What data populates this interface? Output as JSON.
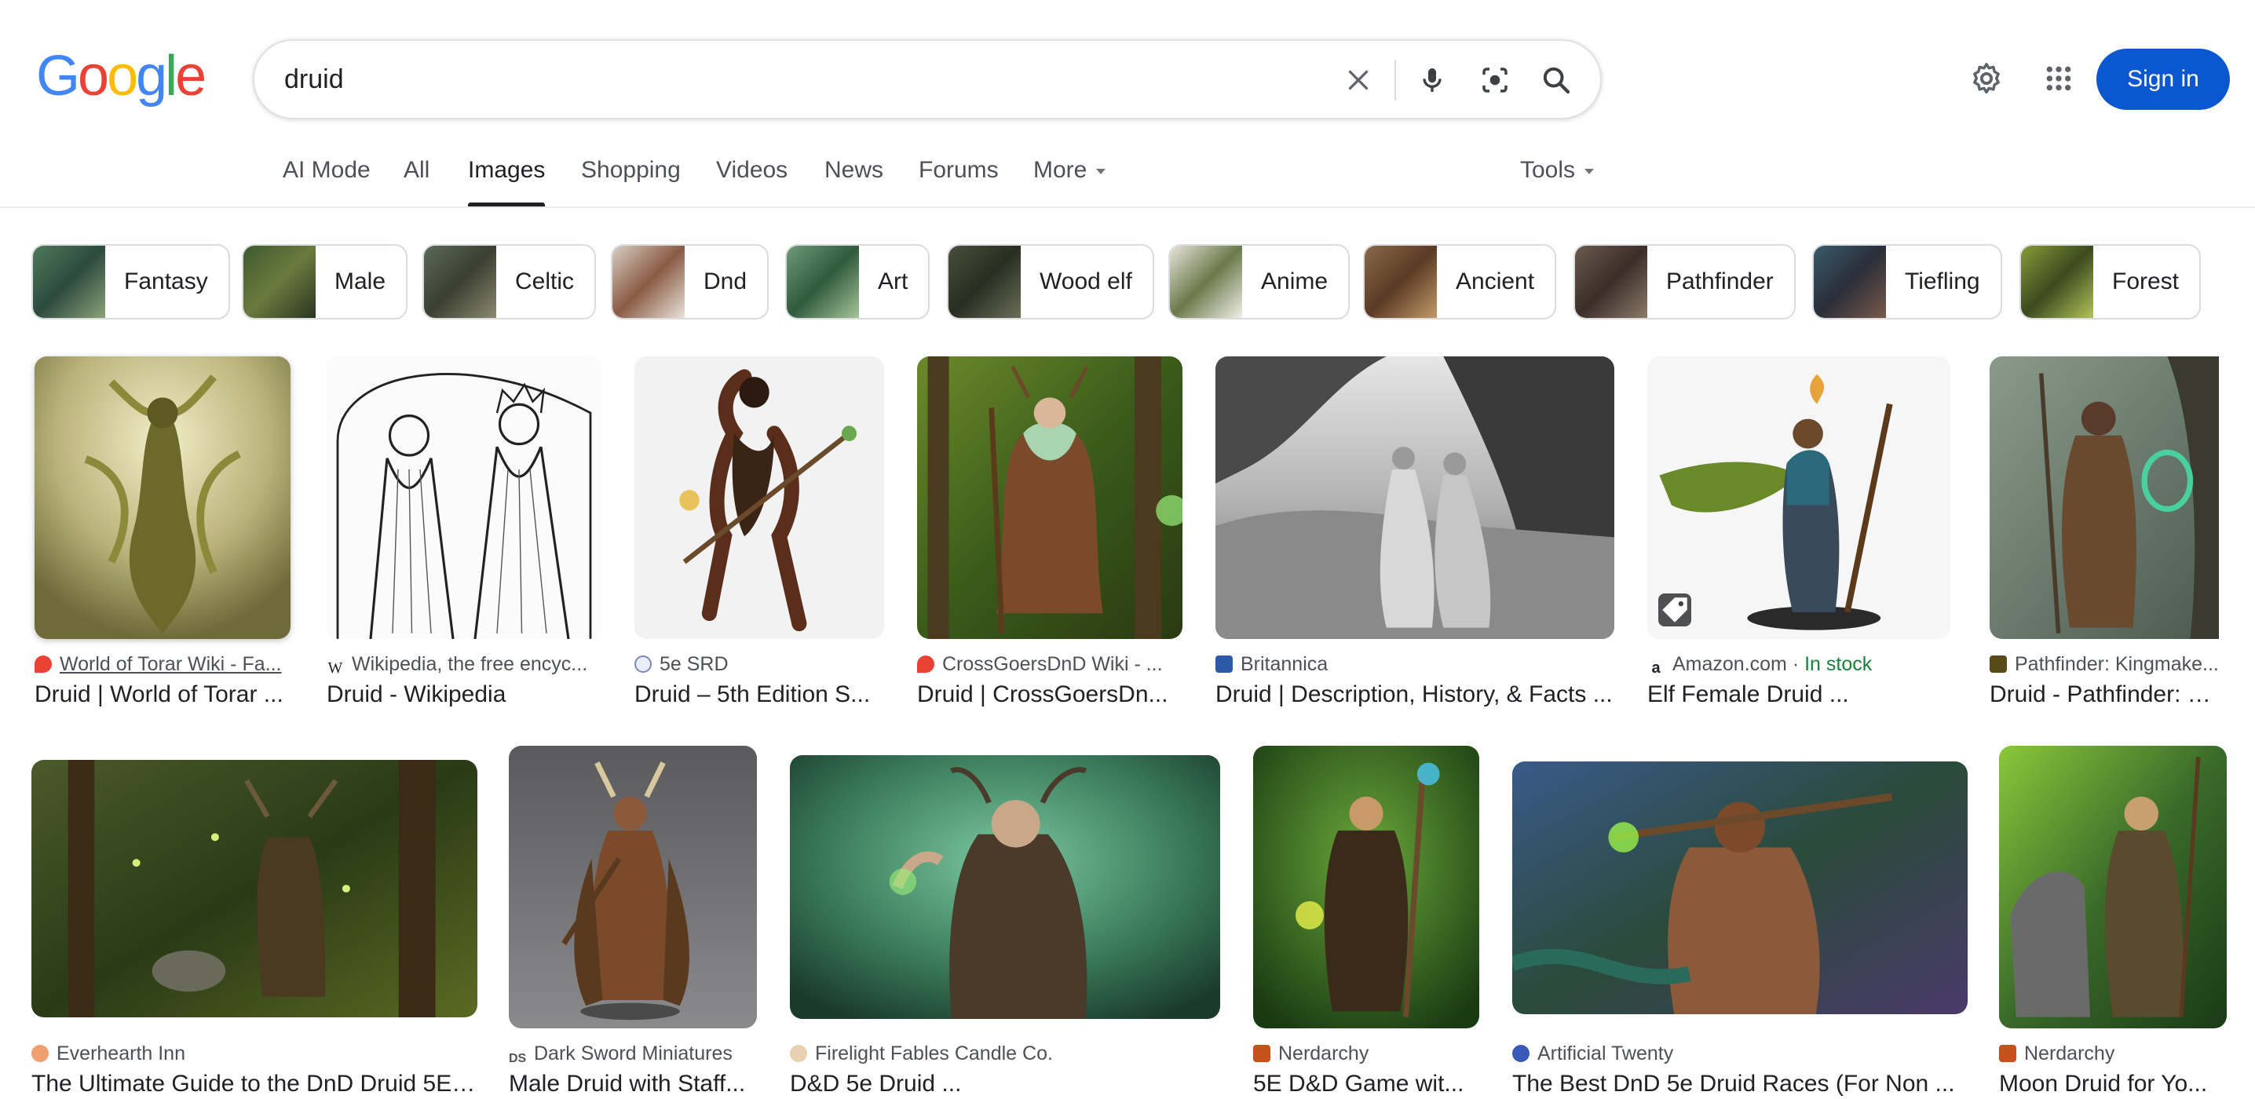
{
  "logo": {
    "text": "Google"
  },
  "search": {
    "query": "druid"
  },
  "header": {
    "sign_in_label": "Sign in",
    "icons": [
      "settings-gear-icon",
      "apps-grid-icon"
    ]
  },
  "search_icons": [
    "clear-x-icon",
    "microphone-icon",
    "lens-camera-icon",
    "search-magnifier-icon"
  ],
  "tabs": [
    {
      "label": "AI Mode"
    },
    {
      "label": "All"
    },
    {
      "label": "Images",
      "active": true
    },
    {
      "label": "Shopping"
    },
    {
      "label": "Videos"
    },
    {
      "label": "News"
    },
    {
      "label": "Forums"
    },
    {
      "label": "More"
    }
  ],
  "tools_label": "Tools",
  "chips": [
    {
      "label": "Fantasy"
    },
    {
      "label": "Male"
    },
    {
      "label": "Celtic"
    },
    {
      "label": "Dnd"
    },
    {
      "label": "Art"
    },
    {
      "label": "Wood elf"
    },
    {
      "label": "Anime"
    },
    {
      "label": "Ancient"
    },
    {
      "label": "Pathfinder"
    },
    {
      "label": "Tiefling"
    },
    {
      "label": "Forest"
    }
  ],
  "results_row1": [
    {
      "source": "World of Torar Wiki - Fa...",
      "title": "Druid | World of Torar ...",
      "icon": "flame-icon"
    },
    {
      "source": "Wikipedia, the free encyc...",
      "title": "Druid - Wikipedia",
      "icon": "wikipedia-icon"
    },
    {
      "source": "5e SRD",
      "title": "Druid – 5th Edition S...",
      "icon": "globe-icon"
    },
    {
      "source": "CrossGoersDnD Wiki - ...",
      "title": "Druid | CrossGoersDn...",
      "icon": "flame-icon"
    },
    {
      "source": "Britannica",
      "title": "Druid | Description, History, & Facts ...",
      "icon": "britannica-icon"
    },
    {
      "source": "Amazon.com",
      "stock": "In stock",
      "title": "Elf Female Druid ...",
      "icon": "amazon-icon",
      "badge": "tag-icon"
    },
    {
      "source": "Pathfinder: Kingmake...",
      "title": "Druid - Pathfinder: K...",
      "icon": "pathfinder-icon"
    }
  ],
  "results_row2": [
    {
      "source": "Everhearth Inn",
      "title": "The Ultimate Guide to the DnD Druid 5E ...",
      "icon": "inn-icon"
    },
    {
      "source": "Dark Sword Miniatures",
      "title": "Male Druid with Staff...",
      "icon": "ds-icon"
    },
    {
      "source": "Firelight Fables Candle Co.",
      "title": "D&D 5e Druid ...",
      "icon": "candle-icon"
    },
    {
      "source": "Nerdarchy",
      "title": "5E D&D Game wit...",
      "icon": "nerdarchy-icon"
    },
    {
      "source": "Artificial Twenty",
      "title": "The Best DnD 5e Druid Races (For Non ...",
      "icon": "a20-icon"
    },
    {
      "source": "Nerdarchy",
      "title": "Moon Druid for Yo...",
      "icon": "nerdarchy-icon"
    }
  ],
  "colors": {
    "accent": "#0b57d0",
    "text": "#202124",
    "muted": "#4d5156",
    "stock": "#188038"
  }
}
